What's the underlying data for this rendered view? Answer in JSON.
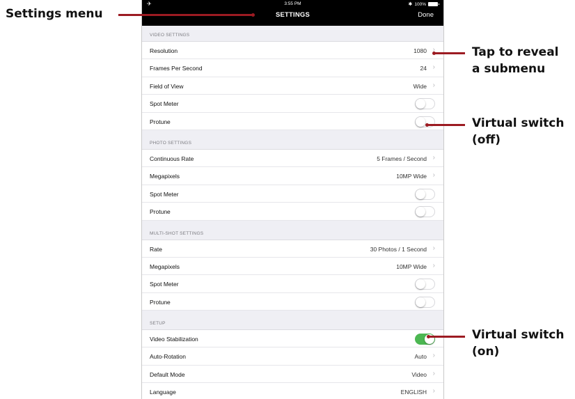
{
  "status_bar": {
    "airplane_icon": "airplane-icon",
    "time": "3:55 PM",
    "bluetooth": "✱",
    "battery": "100%"
  },
  "nav": {
    "title": "SETTINGS",
    "done_label": "Done"
  },
  "sections": [
    {
      "header": "VIDEO SETTINGS",
      "rows": [
        {
          "label": "Resolution",
          "value": "1080",
          "type": "value"
        },
        {
          "label": "Frames Per Second",
          "value": "24",
          "type": "value"
        },
        {
          "label": "Field of View",
          "value": "Wide",
          "type": "value"
        },
        {
          "label": "Spot Meter",
          "type": "toggle",
          "on": false
        },
        {
          "label": "Protune",
          "type": "toggle",
          "on": false
        }
      ]
    },
    {
      "header": "PHOTO SETTINGS",
      "rows": [
        {
          "label": "Continuous Rate",
          "value": "5 Frames / Second",
          "type": "value"
        },
        {
          "label": "Megapixels",
          "value": "10MP Wide",
          "type": "value"
        },
        {
          "label": "Spot Meter",
          "type": "toggle",
          "on": false
        },
        {
          "label": "Protune",
          "type": "toggle",
          "on": false
        }
      ]
    },
    {
      "header": "MULTI-SHOT SETTINGS",
      "rows": [
        {
          "label": "Rate",
          "value": "30 Photos / 1 Second",
          "type": "value"
        },
        {
          "label": "Megapixels",
          "value": "10MP Wide",
          "type": "value"
        },
        {
          "label": "Spot Meter",
          "type": "toggle",
          "on": false
        },
        {
          "label": "Protune",
          "type": "toggle",
          "on": false
        }
      ]
    },
    {
      "header": "SETUP",
      "rows": [
        {
          "label": "Video Stabilization",
          "type": "toggle",
          "on": true
        },
        {
          "label": "Auto-Rotation",
          "value": "Auto",
          "type": "value"
        },
        {
          "label": "Default Mode",
          "value": "Video",
          "type": "value"
        },
        {
          "label": "Language",
          "value": "ENGLISH",
          "type": "value"
        }
      ]
    }
  ],
  "callouts": {
    "settings_menu": "Settings menu",
    "submenu": [
      "Tap to reveal",
      "a submenu"
    ],
    "switch_off": [
      "Virtual switch",
      "(off)"
    ],
    "switch_on": [
      "Virtual switch",
      "(on)"
    ]
  },
  "colors": {
    "toggle_on": "#4cb752",
    "leader_line": "#9c1b22",
    "navbar": "#000000"
  }
}
